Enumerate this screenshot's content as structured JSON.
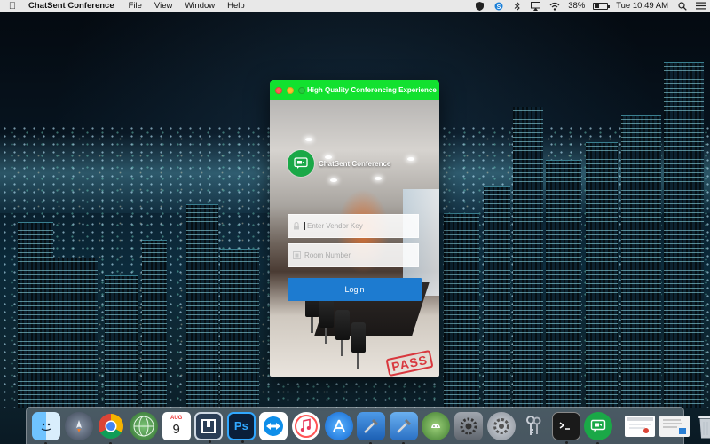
{
  "menubar": {
    "app_name": "ChatSent Conference",
    "menus": [
      "File",
      "View",
      "Window",
      "Help"
    ],
    "battery_percent": "38%",
    "clock": "Tue 10:49 AM",
    "battery_level": 0.38
  },
  "window": {
    "title": "High Quality Conferencing Experience",
    "brand_name": "ChatSent Conference",
    "vendor_key_placeholder": "Enter Vendor Key",
    "room_number_placeholder": "Room Number",
    "login_label": "Login",
    "stamp_text": "PASS",
    "titlebar_color": "#12e12f",
    "login_color": "#1d7bd0"
  },
  "dock": {
    "calendar_month": "AUG",
    "calendar_day": "9",
    "items": [
      {
        "name": "finder-icon",
        "color": "#3aa0f0"
      },
      {
        "name": "launchpad-icon",
        "color": "#556070"
      },
      {
        "name": "chrome-icon",
        "color": "#ffffff"
      },
      {
        "name": "globe-icon",
        "color": "#3c9d3c"
      },
      {
        "name": "calendar-icon",
        "color": "#ffffff"
      },
      {
        "name": "remote-desktop-icon",
        "color": "#2a3d55"
      },
      {
        "name": "photoshop-icon",
        "color": "#0a1f3a"
      },
      {
        "name": "teamviewer-icon",
        "color": "#ffffff"
      },
      {
        "name": "itunes-icon",
        "color": "#ffffff"
      },
      {
        "name": "app-store-icon",
        "color": "#1e88e5"
      },
      {
        "name": "xcode-icon",
        "color": "#3a7fd0"
      },
      {
        "name": "xcode-beta-icon",
        "color": "#3a7fd0"
      },
      {
        "name": "android-studio-icon",
        "color": "#6aa84f"
      },
      {
        "name": "system-preferences-icon",
        "color": "#8a8f96"
      },
      {
        "name": "settings-gear-icon",
        "color": "#b9bec5"
      },
      {
        "name": "keychain-icon",
        "color": "#9aa0a8"
      },
      {
        "name": "terminal-icon",
        "color": "#1a1a1a"
      },
      {
        "name": "chatsent-icon",
        "color": "#1aa847"
      }
    ]
  }
}
